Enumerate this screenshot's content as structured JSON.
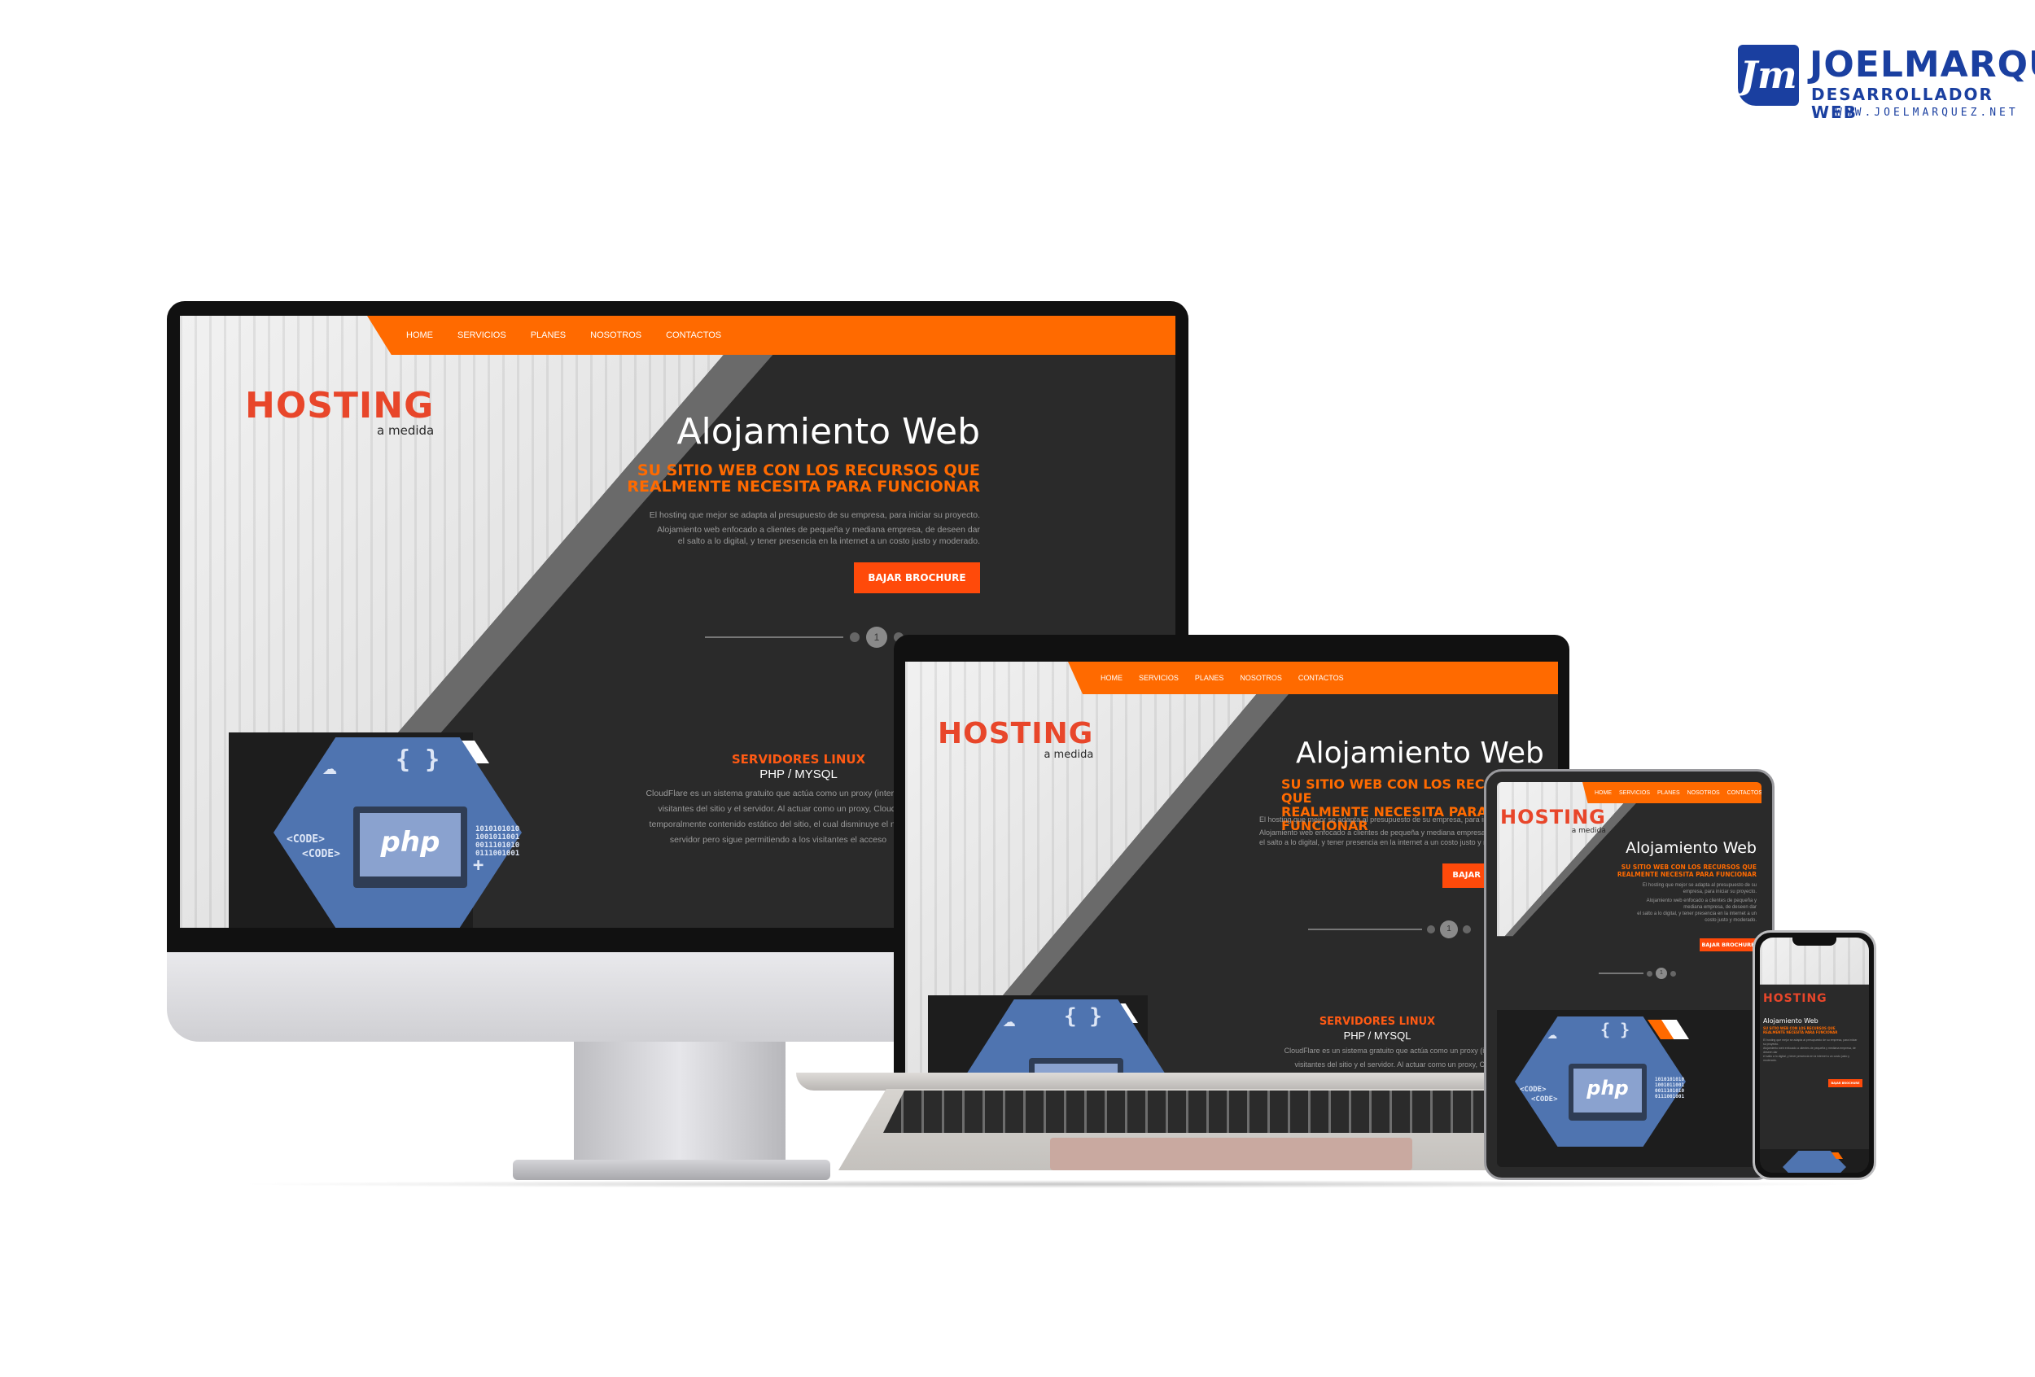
{
  "brand": {
    "monogram": "Jm",
    "name": "JOELMARQUEZ",
    "tagline": "DESARROLLADOR WEB",
    "url": "WWW.JOELMARQUEZ.NET"
  },
  "site": {
    "nav": [
      "HOME",
      "SERVICIOS",
      "PLANES",
      "NOSOTROS",
      "CONTACTOS"
    ],
    "logo": {
      "name": "HOSTING",
      "sub": "a medida"
    },
    "hero": {
      "title": "Alojamiento Web",
      "subtitle_line1": "SU SITIO WEB CON LOS RECURSOS QUE",
      "subtitle_line2": "REALMENTE NECESITA PARA FUNCIONAR",
      "p1": "El hosting que mejor se adapta al presupuesto de su empresa, para iniciar su proyecto.",
      "p2_line1": "Alojamiento web enfocado a clientes de pequeña y mediana empresa, de deseen dar",
      "p2_line2": "el salto a lo digital, y tener presencia en la internet a un costo justo y moderado.",
      "cta": "BAJAR BROCHURE",
      "slide_number": "1"
    },
    "services": {
      "title": "SERVIDORES LINUX",
      "subtitle": "PHP / MYSQL",
      "p_line1": "CloudFlare es un sistema gratuito que actúa como un proxy (intermed",
      "p_line2": "visitantes del sitio y el servidor. Al actuar como un proxy, Cloudf",
      "p_line3": "temporalmente contenido estático del sitio, el cual disminuye el núm",
      "p_line4": "servidor pero sigue permitiendo a los visitantes el acceso"
    },
    "icon_art": {
      "php_label": "php",
      "braces": "{ }",
      "code_label": "<CODE>",
      "binary_1": "1010101010",
      "binary_2": "1001011001",
      "binary_3": "0011101010",
      "binary_4": "0111001001",
      "plus": "+"
    },
    "colors": {
      "accent": "#ff6a00",
      "cta": "#ff4a0a",
      "dark": "#2a2a2a",
      "hex_blue": "#4f74b0",
      "logo_red": "#e8462a"
    }
  }
}
